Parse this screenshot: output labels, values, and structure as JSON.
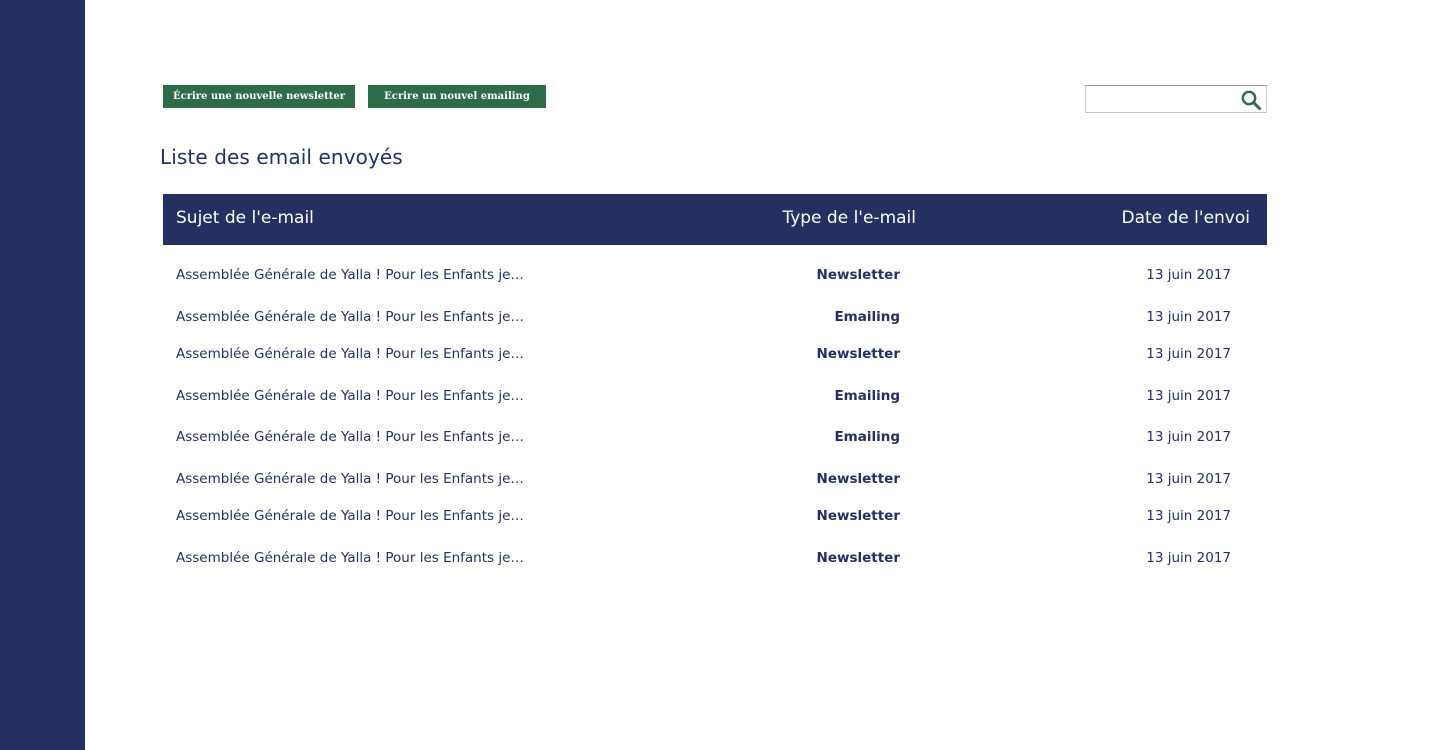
{
  "toolbar": {
    "new_newsletter_label": "Écrire une nouvelle newsletter",
    "new_emailing_label": "Ecrire un nouvel emailing"
  },
  "search": {
    "placeholder": "",
    "value": "",
    "icon": "search-icon"
  },
  "list": {
    "title": "Liste des email envoyés",
    "columns": {
      "subject": "Sujet de l'e-mail",
      "type": "Type de l'e-mail",
      "date": "Date de l'envoi"
    },
    "rows": [
      {
        "subject": "Assemblée Générale de Yalla ! Pour les Enfants je…",
        "type": "Newsletter",
        "date": "13 juin 2017"
      },
      {
        "subject": "Assemblée Générale de Yalla ! Pour les Enfants je…",
        "type": "Emailing",
        "date": "13 juin 2017"
      },
      {
        "subject": "Assemblée Générale de Yalla ! Pour les Enfants je…",
        "type": "Newsletter",
        "date": "13 juin 2017"
      },
      {
        "subject": "Assemblée Générale de Yalla ! Pour les Enfants je…",
        "type": "Emailing",
        "date": "13 juin 2017"
      },
      {
        "subject": "Assemblée Générale de Yalla ! Pour les Enfants je…",
        "type": "Emailing",
        "date": "13 juin 2017"
      },
      {
        "subject": "Assemblée Générale de Yalla ! Pour les Enfants je…",
        "type": "Newsletter",
        "date": "13 juin 2017"
      },
      {
        "subject": "Assemblée Générale de Yalla ! Pour les Enfants je…",
        "type": "Newsletter",
        "date": "13 juin 2017"
      },
      {
        "subject": "Assemblée Générale de Yalla ! Pour les Enfants je…",
        "type": "Newsletter",
        "date": "13 juin 2017"
      }
    ]
  },
  "colors": {
    "navy": "#243160",
    "green": "#2e6b49",
    "background": "#ffffff"
  }
}
